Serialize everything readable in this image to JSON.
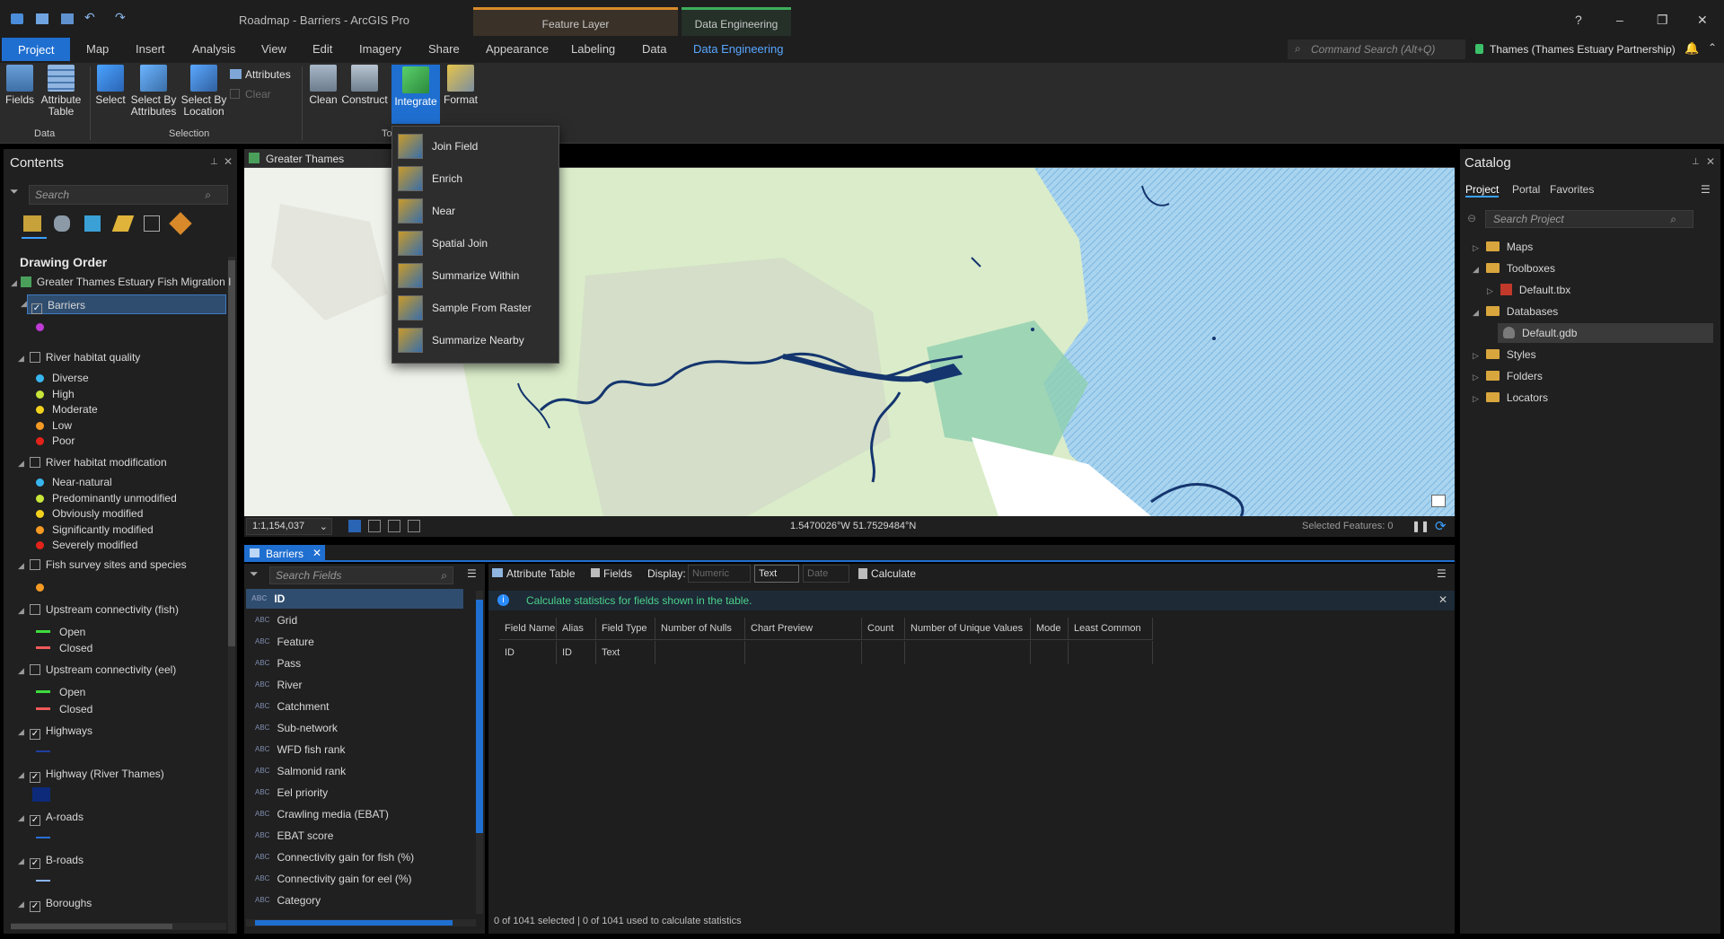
{
  "titlebar": {
    "title": "Roadmap - Barriers - ArcGIS Pro",
    "context_feature_layer": "Feature Layer",
    "context_data_engineering": "Data Engineering",
    "help": "?",
    "minimize": "–",
    "restore": "❐",
    "close": "✕"
  },
  "tabs": {
    "project": "Project",
    "map": "Map",
    "insert": "Insert",
    "analysis": "Analysis",
    "view": "View",
    "edit": "Edit",
    "imagery": "Imagery",
    "share": "Share",
    "appearance": "Appearance",
    "labeling": "Labeling",
    "data": "Data",
    "data_engineering": "Data Engineering",
    "command_search_placeholder": "Command Search (Alt+Q)",
    "portal_user": "Thames (Thames Estuary Partnership)"
  },
  "ribbon": {
    "fields": "Fields",
    "attribute_table": "Attribute Table",
    "select": "Select",
    "select_by_attributes": "Select By Attributes",
    "select_by_location": "Select By Location",
    "attributes": "Attributes",
    "clear": "Clear",
    "clean": "Clean",
    "construct": "Construct",
    "integrate": "Integrate",
    "format": "Format",
    "group_data": "Data",
    "group_selection": "Selection",
    "group_tools": "To"
  },
  "integrate_menu": {
    "items": [
      "Join Field",
      "Enrich",
      "Near",
      "Spatial Join",
      "Summarize Within",
      "Sample From Raster",
      "Summarize Nearby"
    ]
  },
  "contents": {
    "title": "Contents",
    "search_placeholder": "Search",
    "drawing_order": "Drawing Order",
    "map_name": "Greater Thames Estuary Fish Migration I",
    "barriers": "Barriers",
    "river_habitat_quality": "River habitat quality",
    "quality_classes": [
      "Diverse",
      "High",
      "Moderate",
      "Low",
      "Poor"
    ],
    "river_habitat_modification": "River habitat modification",
    "modification_classes": [
      "Near-natural",
      "Predominantly unmodified",
      "Obviously modified",
      "Significantly modified",
      "Severely modified"
    ],
    "fish_survey": "Fish survey sites and species",
    "upstream_fish": "Upstream connectivity (fish)",
    "upstream_eel": "Upstream connectivity (eel)",
    "open": "Open",
    "closed": "Closed",
    "highways": "Highways",
    "highway_thames": "Highway (River Thames)",
    "a_roads": "A-roads",
    "b_roads": "B-roads",
    "boroughs": "Boroughs"
  },
  "map_view": {
    "tab_title": "Greater Thames Estua...gra",
    "scale": "1:1,154,037",
    "coordinates": "1.5470026°W 51.7529484°N",
    "selected_features": "Selected Features: 0"
  },
  "fields_view": {
    "tab_title": "Barriers",
    "search_placeholder": "Search Fields",
    "toolbar": {
      "attribute_table": "Attribute Table",
      "fields": "Fields",
      "display": "Display:",
      "numeric": "Numeric",
      "text": "Text",
      "date": "Date",
      "calculate": "Calculate"
    },
    "info_message": "Calculate statistics for fields shown in the table.",
    "field_list": [
      "ID",
      "Grid",
      "Feature",
      "Pass",
      "River",
      "Catchment",
      "Sub-network",
      "WFD fish rank",
      "Salmonid rank",
      "Eel priority",
      "Crawling media (EBAT)",
      "EBAT score",
      "Connectivity gain for fish (%)",
      "Connectivity gain for eel (%)",
      "Category"
    ],
    "columns": [
      "Field Name",
      "Alias",
      "Field Type",
      "Number of Nulls",
      "Chart Preview",
      "Count",
      "Number of Unique Values",
      "Mode",
      "Least Common"
    ],
    "rows": [
      [
        "ID",
        "ID",
        "Text",
        "",
        "",
        "",
        "",
        "",
        ""
      ]
    ],
    "footer": "0 of 1041 selected | 0 of 1041 used to calculate statistics"
  },
  "catalog": {
    "title": "Catalog",
    "tabs": [
      "Project",
      "Portal",
      "Favorites"
    ],
    "search_placeholder": "Search Project",
    "maps": "Maps",
    "toolboxes": "Toolboxes",
    "default_tbx": "Default.tbx",
    "databases": "Databases",
    "default_gdb": "Default.gdb",
    "styles": "Styles",
    "folders": "Folders",
    "locators": "Locators"
  },
  "colors": {
    "accent": "#1f6fd1",
    "diverse": "#38b6f0",
    "high": "#c8e63a",
    "moderate": "#f2d21d",
    "low": "#f59a23",
    "poor": "#e2231a",
    "open": "#3ddc3d",
    "closed": "#f05a5a",
    "barrier_point": "#c03ad6"
  }
}
